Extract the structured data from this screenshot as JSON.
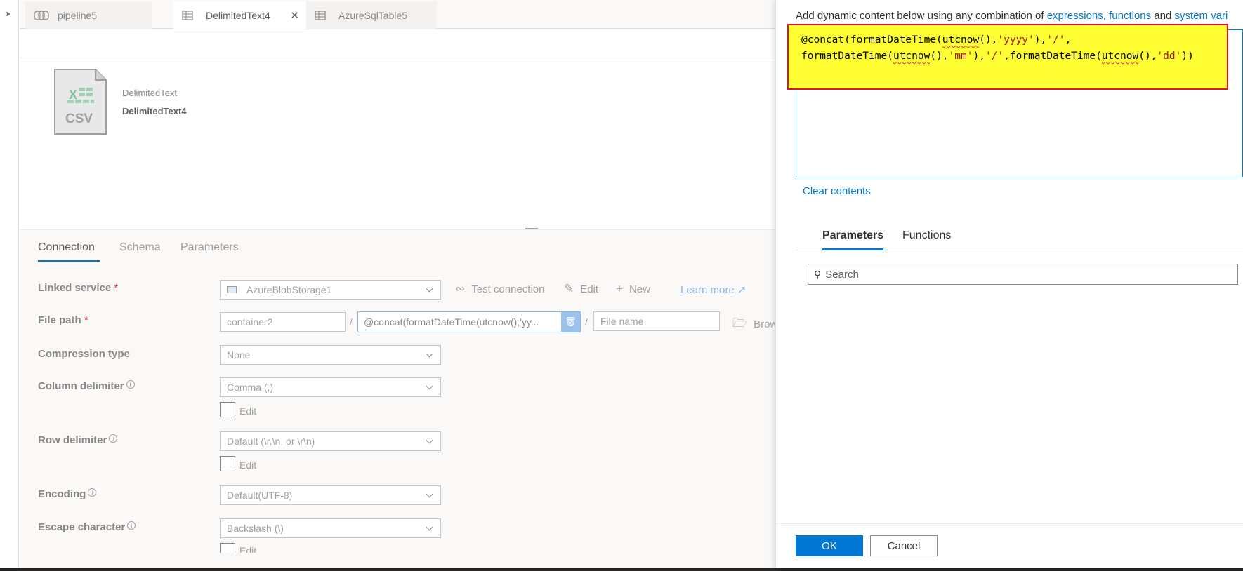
{
  "tabs": [
    {
      "label": "pipeline5",
      "icon": "pipeline-icon",
      "active": false
    },
    {
      "label": "DelimitedText4",
      "icon": "table-icon",
      "active": true,
      "close": "✕"
    },
    {
      "label": "AzureSqlTable5",
      "icon": "table-icon",
      "active": false
    }
  ],
  "dataset": {
    "icon_text": "CSV",
    "type": "DelimitedText",
    "name": "DelimitedText4"
  },
  "panel_tabs": [
    "Connection",
    "Schema",
    "Parameters"
  ],
  "form": {
    "linked_service": {
      "label": "Linked service",
      "required": "*",
      "value": "AzureBlobStorage1",
      "test_connection": "Test connection",
      "edit": "Edit",
      "new": "New",
      "learn_more": "Learn more"
    },
    "file_path": {
      "label": "File path",
      "required": "*",
      "container": "container2",
      "directory": "@concat(formatDateTime(utcnow(),'yy...",
      "file_placeholder": "File name",
      "browse": "Brow",
      "sep": "/"
    },
    "compression_type": {
      "label": "Compression type",
      "value": "None"
    },
    "column_delimiter": {
      "label": "Column delimiter",
      "value": "Comma (,)",
      "edit": "Edit"
    },
    "row_delimiter": {
      "label": "Row delimiter",
      "value": "Default (\\r,\\n, or \\r\\n)",
      "edit": "Edit"
    },
    "encoding": {
      "label": "Encoding",
      "value": "Default(UTF-8)"
    },
    "escape_character": {
      "label": "Escape character",
      "value": "Backslash (\\)",
      "edit": "Edit"
    }
  },
  "dialog": {
    "hint_prefix": "Add dynamic content below using any combination of ",
    "hint_link1": "expressions, functions",
    "hint_mid": " and ",
    "hint_link2": "system vari",
    "code": {
      "l1_a": "@concat(formatDateTime(",
      "l1_b": "utcnow",
      "l1_c": "(),",
      "l1_d": "'yyyy'",
      "l1_e": "),",
      "l1_f": "'/'",
      "l1_g": ",",
      "l2_a": "formatDateTime(",
      "l2_b": "utcnow",
      "l2_c": "(),",
      "l2_d": "'mm'",
      "l2_e": "),",
      "l2_f": "'/'",
      "l2_g": ",formatDateTime(",
      "l2_h": "utcnow",
      "l2_i": "(),",
      "l2_j": "'dd'",
      "l2_k": "))"
    },
    "clear_contents": "Clear contents",
    "tabs": [
      "Parameters",
      "Functions"
    ],
    "search_placeholder": "Search",
    "ok": "OK",
    "cancel": "Cancel"
  },
  "colors": {
    "accent": "#0078d4",
    "highlight": "#ffff33",
    "highlight_border": "#e81123",
    "string": "#a31515"
  }
}
